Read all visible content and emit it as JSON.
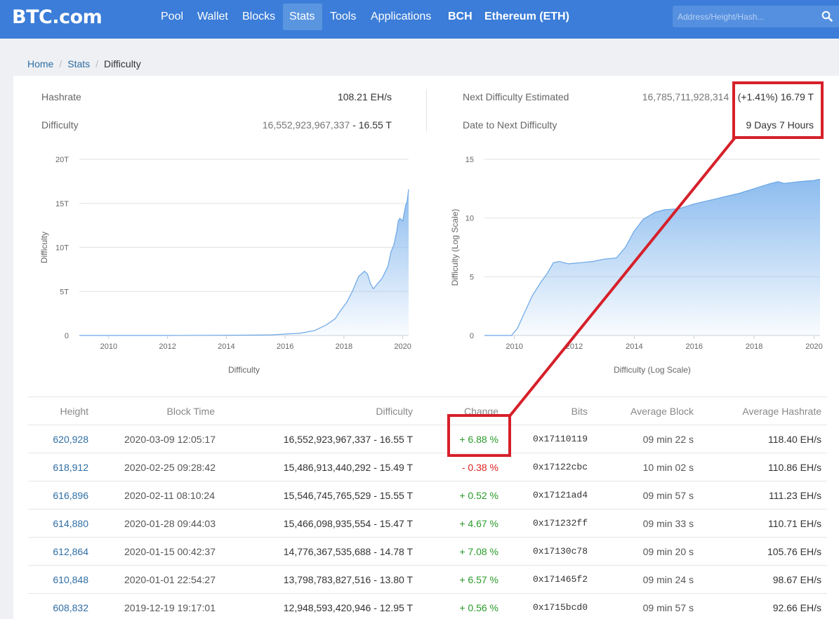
{
  "nav": {
    "logo": "BTC.com",
    "items": [
      "Pool",
      "Wallet",
      "Blocks",
      "Stats",
      "Tools",
      "Applications",
      "BCH",
      "Ethereum (ETH)"
    ],
    "active_index": 3,
    "search_placeholder": "Address/Height/Hash..."
  },
  "breadcrumb": {
    "home": "Home",
    "stats": "Stats",
    "current": "Difficulty"
  },
  "stats": {
    "hashrate_label": "Hashrate",
    "hashrate_value": "108.21 EH/s",
    "difficulty_label": "Difficulty",
    "difficulty_raw": "16,552,923,967,337",
    "difficulty_short": "16.55 T",
    "next_label": "Next Difficulty Estimated",
    "next_raw": "16,785,711,928,314",
    "next_change": "(+1.41%) 16.79 T",
    "date_label": "Date to Next Difficulty",
    "date_value": "9 Days 7 Hours"
  },
  "chart_data": [
    {
      "type": "area",
      "title": "",
      "xlabel": "Difficulty",
      "ylabel": "Difficulty",
      "y_ticks": [
        "0",
        "5T",
        "10T",
        "15T",
        "20T"
      ],
      "x_ticks": [
        "2010",
        "2012",
        "2014",
        "2016",
        "2018",
        "2020"
      ],
      "xlim": [
        2009.0,
        2020.2
      ],
      "ylim": [
        0,
        20
      ],
      "color": "#8cbcef",
      "x": [
        2009.0,
        2012.0,
        2014.0,
        2015.5,
        2016.5,
        2017.0,
        2017.4,
        2017.7,
        2017.9,
        2018.1,
        2018.3,
        2018.5,
        2018.7,
        2018.8,
        2018.9,
        2019.0,
        2019.1,
        2019.3,
        2019.5,
        2019.6,
        2019.7,
        2019.8,
        2019.85,
        2019.9,
        2020.0,
        2020.1,
        2020.15,
        2020.2
      ],
      "y": [
        0,
        0,
        0.02,
        0.06,
        0.25,
        0.55,
        1.2,
        1.9,
        2.9,
        3.8,
        5.1,
        6.7,
        7.3,
        7.0,
        5.9,
        5.3,
        5.7,
        6.5,
        7.9,
        9.5,
        10.3,
        11.9,
        13.0,
        13.3,
        13.0,
        14.8,
        15.2,
        16.6
      ]
    },
    {
      "type": "area",
      "title": "",
      "xlabel": "Difficulty (Log Scale)",
      "ylabel": "Difficulty (Log Scale)",
      "y_ticks": [
        "0",
        "5",
        "10",
        "15"
      ],
      "x_ticks": [
        "2010",
        "2012",
        "2014",
        "2016",
        "2018",
        "2020"
      ],
      "xlim": [
        2009.0,
        2020.2
      ],
      "ylim": [
        0,
        15
      ],
      "color": "#8cbcef",
      "x": [
        2009.0,
        2009.9,
        2010.1,
        2010.4,
        2010.6,
        2010.9,
        2011.1,
        2011.3,
        2011.5,
        2011.8,
        2012.2,
        2012.6,
        2013.0,
        2013.4,
        2013.7,
        2014.0,
        2014.3,
        2014.7,
        2015.0,
        2015.5,
        2016.0,
        2016.5,
        2017.0,
        2017.5,
        2018.0,
        2018.5,
        2018.8,
        2019.0,
        2019.5,
        2020.0,
        2020.2
      ],
      "y": [
        0,
        0,
        0.6,
        2.3,
        3.4,
        4.6,
        5.3,
        6.2,
        6.3,
        6.1,
        6.2,
        6.3,
        6.5,
        6.6,
        7.5,
        8.9,
        9.9,
        10.5,
        10.7,
        10.8,
        11.2,
        11.5,
        11.8,
        12.1,
        12.5,
        12.9,
        13.1,
        12.95,
        13.1,
        13.2,
        13.3
      ]
    }
  ],
  "table": {
    "headers": {
      "height": "Height",
      "time": "Block Time",
      "difficulty": "Difficulty",
      "change": "Change",
      "bits": "Bits",
      "avg_block": "Average Block",
      "avg_hashrate": "Average Hashrate"
    },
    "rows": [
      {
        "height": "620,928",
        "time": "2020-03-09 12:05:17",
        "difficulty": "16,552,923,967,337 - 16.55 T",
        "change": "+ 6.88 %",
        "bits": "0x17110119",
        "avg_block": "09 min 22 s",
        "avg_hashrate": "118.40 EH/s"
      },
      {
        "height": "618,912",
        "time": "2020-02-25 09:28:42",
        "difficulty": "15,486,913,440,292 - 15.49 T",
        "change": "- 0.38 %",
        "bits": "0x17122cbc",
        "avg_block": "10 min 02 s",
        "avg_hashrate": "110.86 EH/s"
      },
      {
        "height": "616,896",
        "time": "2020-02-11 08:10:24",
        "difficulty": "15,546,745,765,529 - 15.55 T",
        "change": "+ 0.52 %",
        "bits": "0x17121ad4",
        "avg_block": "09 min 57 s",
        "avg_hashrate": "111.23 EH/s"
      },
      {
        "height": "614,880",
        "time": "2020-01-28 09:44:03",
        "difficulty": "15,466,098,935,554 - 15.47 T",
        "change": "+ 4.67 %",
        "bits": "0x171232ff",
        "avg_block": "09 min 33 s",
        "avg_hashrate": "110.71 EH/s"
      },
      {
        "height": "612,864",
        "time": "2020-01-15 00:42:37",
        "difficulty": "14,776,367,535,688 - 14.78 T",
        "change": "+ 7.08 %",
        "bits": "0x17130c78",
        "avg_block": "09 min 20 s",
        "avg_hashrate": "105.76 EH/s"
      },
      {
        "height": "610,848",
        "time": "2020-01-01 22:54:27",
        "difficulty": "13,798,783,827,516 - 13.80 T",
        "change": "+ 6.57 %",
        "bits": "0x171465f2",
        "avg_block": "09 min 24 s",
        "avg_hashrate": "98.67 EH/s"
      },
      {
        "height": "608,832",
        "time": "2019-12-19 19:17:01",
        "difficulty": "12,948,593,420,946 - 12.95 T",
        "change": "+ 0.56 %",
        "bits": "0x1715bcd0",
        "avg_block": "09 min 57 s",
        "avg_hashrate": "92.66 EH/s"
      }
    ]
  },
  "colors": {
    "nav_bg": "#3b7dd8",
    "positive": "#2a9b2a",
    "negative": "#dd2222",
    "annotation": "#d6202a",
    "link": "#2f6ea5"
  }
}
